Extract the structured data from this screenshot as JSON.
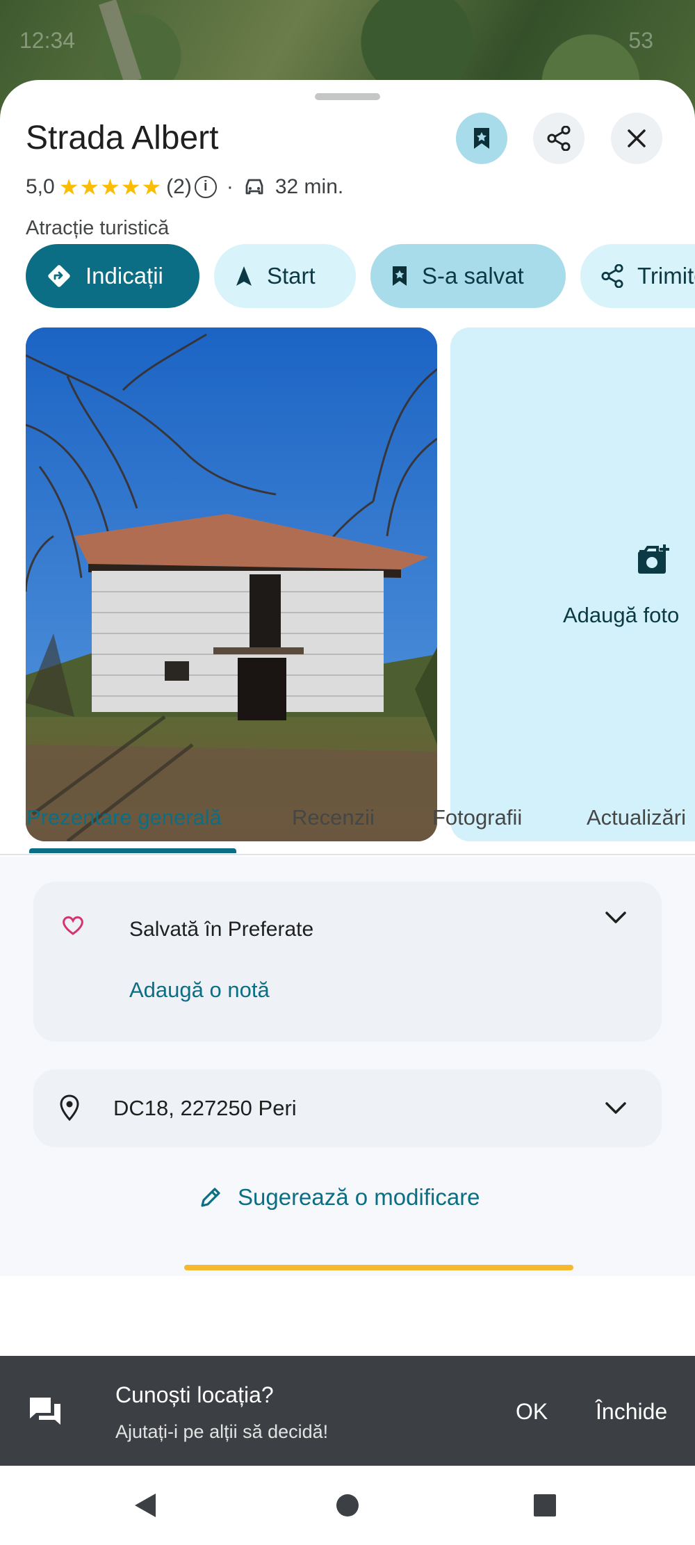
{
  "status": {
    "time": "12:34",
    "battery": "53"
  },
  "place": {
    "title": "Strada Albert",
    "rating": "5,0",
    "stars": "★★★★★",
    "review_count": "(2)",
    "separator": "·",
    "drive_time": "32 min.",
    "category": "Atracție turistică"
  },
  "actions": {
    "directions": "Indicații",
    "start": "Start",
    "saved": "S-a salvat",
    "send": "Trimite"
  },
  "media": {
    "add_photo": "Adaugă foto"
  },
  "tabs": [
    {
      "label": "Prezentare generală",
      "active": true
    },
    {
      "label": "Recenzii",
      "active": false
    },
    {
      "label": "Fotografii",
      "active": false
    },
    {
      "label": "Actualizări",
      "active": false
    }
  ],
  "saved_card": {
    "label": "Salvată în Preferate",
    "add_note": "Adaugă o notă"
  },
  "address": {
    "text": "DC18, 227250 Peri"
  },
  "suggest_edit": "Sugerează o modificare",
  "snackbar": {
    "title": "Cunoști locația?",
    "subtitle": "Ajutați-i pe alții să decidă!",
    "ok": "OK",
    "close": "Închide"
  },
  "colors": {
    "accent": "#0b6e84",
    "chip_light": "#d8f3fa",
    "chip_selected": "#a8dcea",
    "star": "#fbbc04",
    "heart": "#d6336c",
    "progress": "#f5b82e"
  },
  "icons": [
    "bookmark-icon",
    "share-icon",
    "close-icon",
    "info-icon",
    "car-icon",
    "directions-icon",
    "navigation-arrow-icon",
    "add-photo-icon",
    "heart-icon",
    "chevron-down-icon",
    "location-pin-icon",
    "pencil-icon",
    "feedback-icon",
    "back-icon",
    "home-icon",
    "recents-icon"
  ]
}
